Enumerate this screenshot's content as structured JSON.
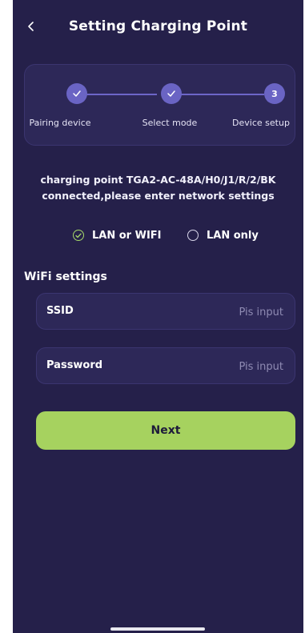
{
  "header": {
    "title": "Setting Charging Point",
    "back_icon": "chevron-left-icon"
  },
  "steps": [
    {
      "label": "Pairing device",
      "state": "done",
      "icon": "check-icon"
    },
    {
      "label": "Select mode",
      "state": "done",
      "icon": "check-icon"
    },
    {
      "label": "Device setup",
      "state": "current",
      "number": "3"
    }
  ],
  "message": {
    "line1": "charging point TGA2-AC-48A/H0/J1/R/2/BK",
    "line2": "connected,please enter network settings"
  },
  "network_mode": {
    "options": [
      {
        "label": "LAN or WIFI",
        "selected": true
      },
      {
        "label": "LAN only",
        "selected": false
      }
    ]
  },
  "wifi": {
    "section_title": "WiFi settings",
    "ssid": {
      "label": "SSID",
      "placeholder": "Pis input",
      "value": ""
    },
    "password": {
      "label": "Password",
      "placeholder": "Pis input",
      "value": ""
    }
  },
  "actions": {
    "next_label": "Next"
  },
  "colors": {
    "background": "#25204a",
    "card": "#2d2858",
    "accent_green": "#a6d25f",
    "step_purple": "#6a64c4"
  }
}
